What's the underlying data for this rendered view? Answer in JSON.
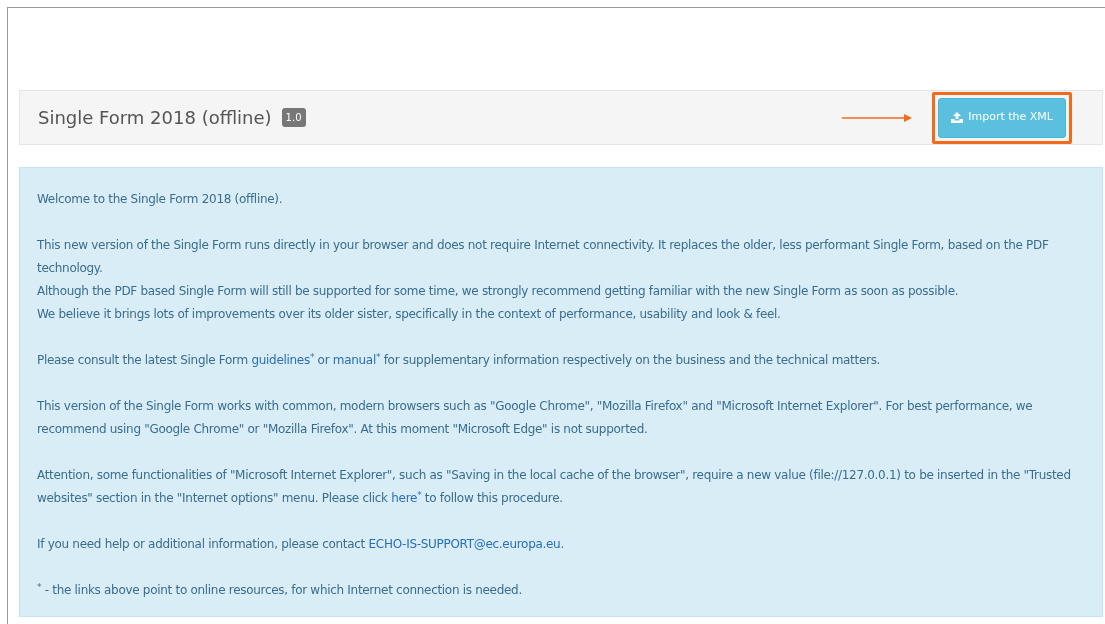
{
  "header": {
    "title": "Single Form 2018 (offline)",
    "version_badge": "1.0",
    "import_button": {
      "label": "Import the XML",
      "highlighted": true
    }
  },
  "info_panel": {
    "paragraphs": [
      {
        "lines": [
          [
            {
              "kind": "text",
              "text": "Welcome to the Single Form 2018 (offline)."
            }
          ]
        ]
      },
      {
        "lines": [
          [
            {
              "kind": "text",
              "text": "This new version of the Single Form runs directly in your browser and does not require Internet connectivity. It replaces the older, less performant Single Form, based on the PDF technology."
            }
          ],
          [
            {
              "kind": "text",
              "text": "Although the PDF based Single Form will still be supported for some time, we strongly recommend getting familiar with the new Single Form as soon as possible."
            }
          ],
          [
            {
              "kind": "text",
              "text": "We believe it brings lots of improvements over its older sister, specifically in the context of performance, usability and look & feel."
            }
          ]
        ]
      },
      {
        "lines": [
          [
            {
              "kind": "text",
              "text": "Please consult the latest Single Form"
            },
            {
              "kind": "link",
              "text": "guidelines$^{*}$"
            },
            {
              "kind": "text",
              "text": "or"
            },
            {
              "kind": "link",
              "text": "manual$^{*}$"
            },
            {
              "kind": "text",
              "text": "for supplementary information respectively on the business and the technical matters."
            }
          ]
        ]
      },
      {
        "lines": [
          [
            {
              "kind": "text",
              "text": "This version of the Single Form works with common, modern browsers such as \"Google Chrome\", \"Mozilla Firefox\" and \"Microsoft Internet Explorer\". For best performance, we recommend using \"Google Chrome\" or \"Mozilla Firefox\". At this moment \"Microsoft Edge\" is not supported."
            }
          ]
        ]
      },
      {
        "lines": [
          [
            {
              "kind": "text",
              "text": "Attention, some functionalities of \"Microsoft Internet Explorer\", such as \"Saving in the local cache of the browser\", require a new value (file://127.0.0.1) to be inserted in the \"Trusted websites\" section in the \"Internet options\" menu. Please click"
            },
            {
              "kind": "link",
              "text": "here$^{*}$"
            },
            {
              "kind": "text",
              "text": "to follow this procedure."
            }
          ]
        ]
      },
      {
        "lines": [
          [
            {
              "kind": "text",
              "text": "If you need help or additional information, please contact"
            },
            {
              "kind": "link",
              "text": "ECHO-IS-SUPPORT@ec.europa.eu"
            },
            {
              "kind": "text",
              "text": "."
            }
          ]
        ]
      },
      {
        "lines": [
          [
            {
              "kind": "text",
              "text": "$^{*}$ - the links above point to online resources, for which Internet connection is needed."
            }
          ]
        ]
      }
    ]
  }
}
